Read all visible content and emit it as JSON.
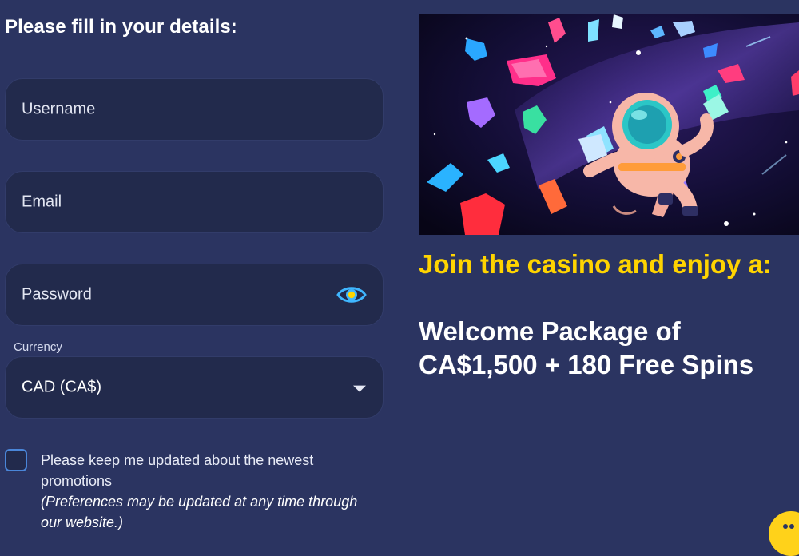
{
  "form": {
    "title": "Please fill in your details:",
    "username_placeholder": "Username",
    "email_placeholder": "Email",
    "password_placeholder": "Password",
    "currency_label": "Currency",
    "currency_value": "CAD (CA$)",
    "consent_text": "Please keep me updated about the newest promotions",
    "consent_note": "(Preferences may be updated at any time through our website.)"
  },
  "promo": {
    "headline": "Join the casino and enjoy a:",
    "offer": "Welcome Package of CA$1,500 + 180 Free Spins"
  },
  "colors": {
    "background": "#2b3461",
    "field_background": "#222a4c",
    "headline_yellow": "#ffd400",
    "eye_icon_blue": "#3fb6ff",
    "checkbox_border": "#4a86d9"
  },
  "icons": {
    "password_toggle": "eye-icon",
    "currency_dropdown": "caret-down-icon",
    "chat": "chat-bubble-icon"
  }
}
